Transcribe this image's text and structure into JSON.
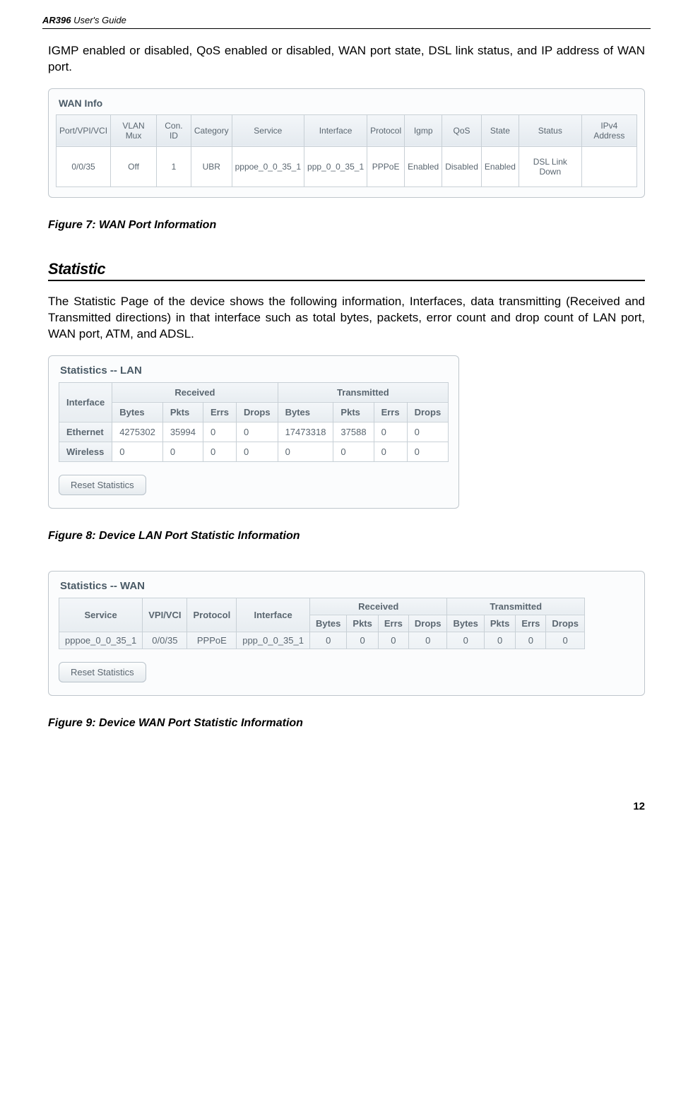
{
  "header": {
    "model": "AR396",
    "suffix": " User's Guide"
  },
  "intro_text": "IGMP enabled or disabled, QoS enabled or disabled, WAN port state, DSL link status, and IP address of WAN port.",
  "wan_info": {
    "title": "WAN Info",
    "headers": [
      "Port/VPI/VCI",
      "VLAN Mux",
      "Con. ID",
      "Category",
      "Service",
      "Interface",
      "Protocol",
      "Igmp",
      "QoS",
      "State",
      "Status",
      "IPv4 Address"
    ],
    "row": [
      "0/0/35",
      "Off",
      "1",
      "UBR",
      "pppoe_0_0_35_1",
      "ppp_0_0_35_1",
      "PPPoE",
      "Enabled",
      "Disabled",
      "Enabled",
      "DSL Link Down",
      ""
    ]
  },
  "figure7": "Figure 7: WAN Port Information",
  "section_heading": "Statistic",
  "statistic_text": "The Statistic Page of the device shows the following information, Interfaces, data transmitting (Received and Transmitted directions) in that interface such as total bytes, packets, error count and drop count of LAN port, WAN port, ATM, and ADSL.",
  "lan_stats": {
    "title": "Statistics -- LAN",
    "col_groups": [
      "Interface",
      "Received",
      "Transmitted"
    ],
    "sub_headers": [
      "Bytes",
      "Pkts",
      "Errs",
      "Drops",
      "Bytes",
      "Pkts",
      "Errs",
      "Drops"
    ],
    "rows": [
      {
        "iface": "Ethernet",
        "vals": [
          "4275302",
          "35994",
          "0",
          "0",
          "17473318",
          "37588",
          "0",
          "0"
        ]
      },
      {
        "iface": "Wireless",
        "vals": [
          "0",
          "0",
          "0",
          "0",
          "0",
          "0",
          "0",
          "0"
        ]
      }
    ],
    "reset": "Reset Statistics"
  },
  "figure8": "Figure 8: Device LAN Port Statistic Information",
  "wan_stats": {
    "title": "Statistics -- WAN",
    "top_headers": [
      "Service",
      "VPI/VCI",
      "Protocol",
      "Interface",
      "Received",
      "Transmitted"
    ],
    "sub_headers": [
      "Bytes",
      "Pkts",
      "Errs",
      "Drops",
      "Bytes",
      "Pkts",
      "Errs",
      "Drops"
    ],
    "row": [
      "pppoe_0_0_35_1",
      "0/0/35",
      "PPPoE",
      "ppp_0_0_35_1",
      "0",
      "0",
      "0",
      "0",
      "0",
      "0",
      "0",
      "0"
    ],
    "reset": "Reset Statistics"
  },
  "figure9": "Figure 9: Device WAN Port Statistic Information",
  "page_number": "12"
}
